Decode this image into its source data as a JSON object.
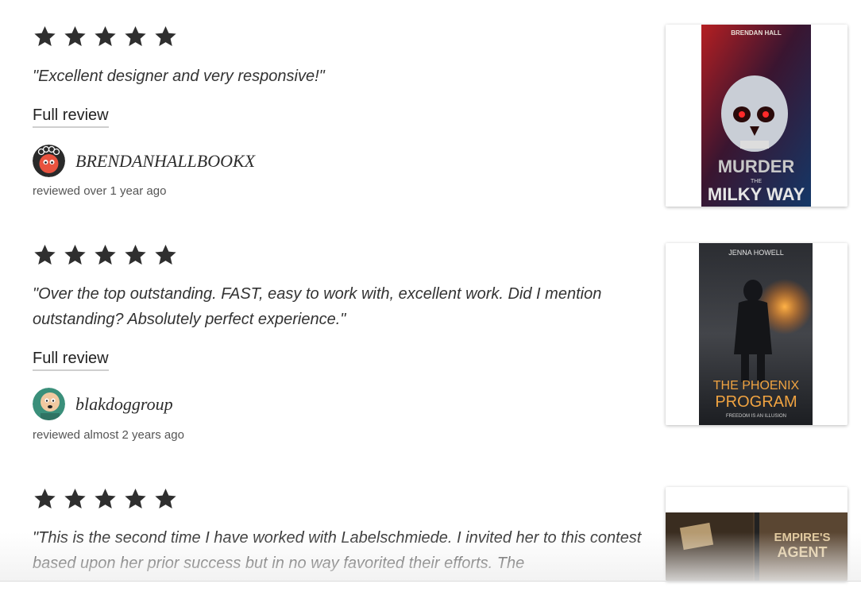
{
  "reviews": [
    {
      "rating": 5,
      "quote": "\"Excellent designer and very responsive!\"",
      "link_label": "Full review",
      "reviewer": "BRENDANHALLBOOKX",
      "meta": "reviewed over 1 year ago",
      "cover": {
        "author": "BRENDAN HALL",
        "title_line1": "MURDER",
        "title_small": "THE",
        "title_line2": "MILKY WAY"
      }
    },
    {
      "rating": 5,
      "quote": "\"Over the top outstanding. FAST, easy to work with, excellent work. Did I mention outstanding? Absolutely perfect experience.\"",
      "link_label": "Full review",
      "reviewer": "blakdoggroup",
      "meta": "reviewed almost 2 years ago",
      "cover": {
        "author": "JENNA HOWELL",
        "title_line1": "THE PHOENIX",
        "title_line2": "PROGRAM",
        "tagline": "FREEDOM IS AN ILLUSION"
      }
    },
    {
      "rating": 5,
      "quote": "\"This is the second time I have worked with Labelschmiede. I invited her to this contest based upon her prior success but in no way favorited their efforts. The",
      "cover": {
        "title_line1": "EMPIRE'S",
        "title_line2": "AGENT"
      }
    }
  ],
  "icons": {
    "star": "star-icon"
  },
  "colors": {
    "star": "#2f2f2f",
    "link_underline": "#cfcfcf",
    "meta_text": "#555555"
  }
}
